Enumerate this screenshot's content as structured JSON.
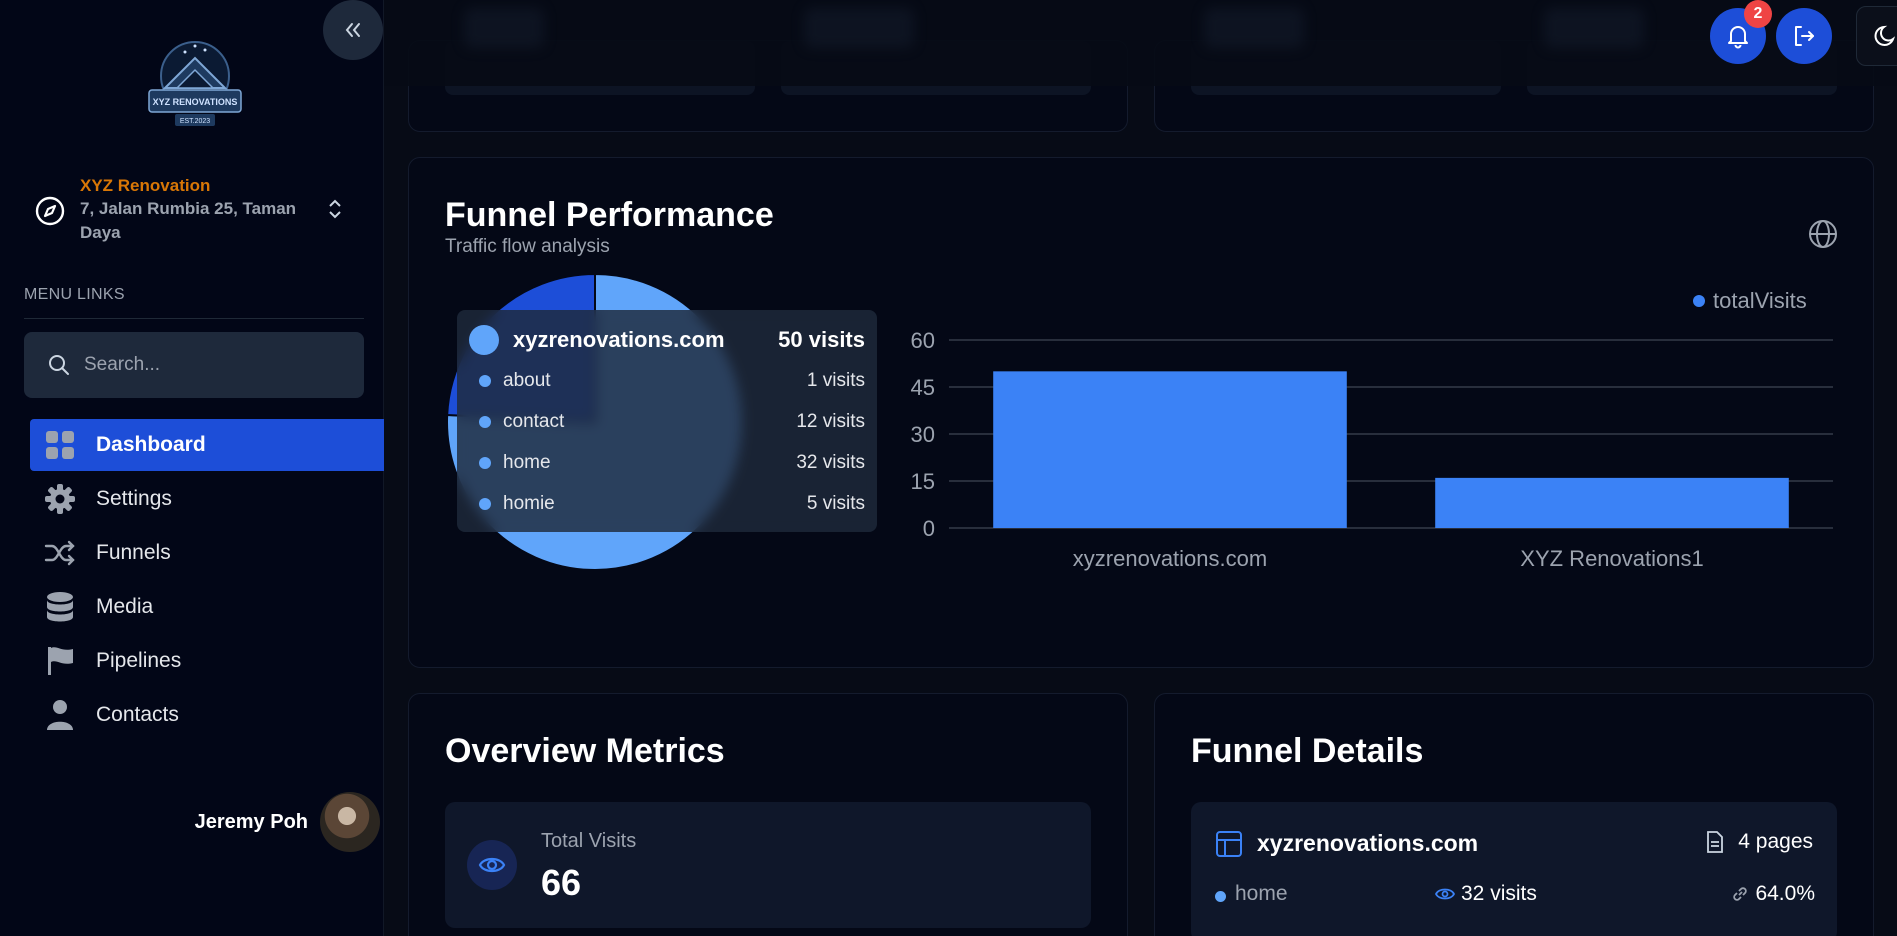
{
  "sidebar": {
    "collapse_icon": "chevrons-left-icon",
    "logo_text": "XYZ RENOVATIONS",
    "logo_est": "EST.2023",
    "workspace": {
      "name": "XYZ Renovation",
      "address": "7, Jalan Rumbia 25, Taman Daya"
    },
    "menu_links_label": "MENU LINKS",
    "search_placeholder": "Search...",
    "items": [
      {
        "label": "Dashboard",
        "icon": "grid-icon",
        "active": true
      },
      {
        "label": "Settings",
        "icon": "gear-icon",
        "active": false
      },
      {
        "label": "Funnels",
        "icon": "shuffle-icon",
        "active": false
      },
      {
        "label": "Media",
        "icon": "database-icon",
        "active": false
      },
      {
        "label": "Pipelines",
        "icon": "flag-icon",
        "active": false
      },
      {
        "label": "Contacts",
        "icon": "user-icon",
        "active": false
      }
    ],
    "user_name": "Jeremy Poh"
  },
  "topbar": {
    "notification_count": "2"
  },
  "funnel_performance": {
    "title": "Funnel Performance",
    "subtitle": "Traffic flow analysis",
    "tooltip": {
      "name": "xyzrenovations.com",
      "total": "50 visits",
      "rows": [
        {
          "label": "about",
          "value": "1 visits"
        },
        {
          "label": "contact",
          "value": "12 visits"
        },
        {
          "label": "home",
          "value": "32 visits"
        },
        {
          "label": "homie",
          "value": "5 visits"
        }
      ]
    }
  },
  "chart_data": [
    {
      "type": "pie",
      "categories": [
        "xyzrenovations.com",
        "XYZ Renovations1"
      ],
      "values": [
        50,
        16
      ],
      "colors": [
        "#60a5fa",
        "#1d4ed8"
      ]
    },
    {
      "type": "bar",
      "categories": [
        "xyzrenovations.com",
        "XYZ Renovations1"
      ],
      "series": [
        {
          "name": "totalVisits",
          "values": [
            50,
            16
          ]
        }
      ],
      "ylim": [
        0,
        60
      ],
      "yticks": [
        0,
        15,
        30,
        45,
        60
      ],
      "grid": true,
      "legend": "top-right",
      "color": "#3b82f6"
    }
  ],
  "overview": {
    "title": "Overview Metrics",
    "metric_label": "Total Visits",
    "metric_value": "66"
  },
  "funnel_details": {
    "title": "Funnel Details",
    "name": "xyzrenovations.com",
    "pages": "4 pages",
    "row": {
      "label": "home",
      "visits": "32 visits",
      "percent": "64.0%"
    }
  }
}
